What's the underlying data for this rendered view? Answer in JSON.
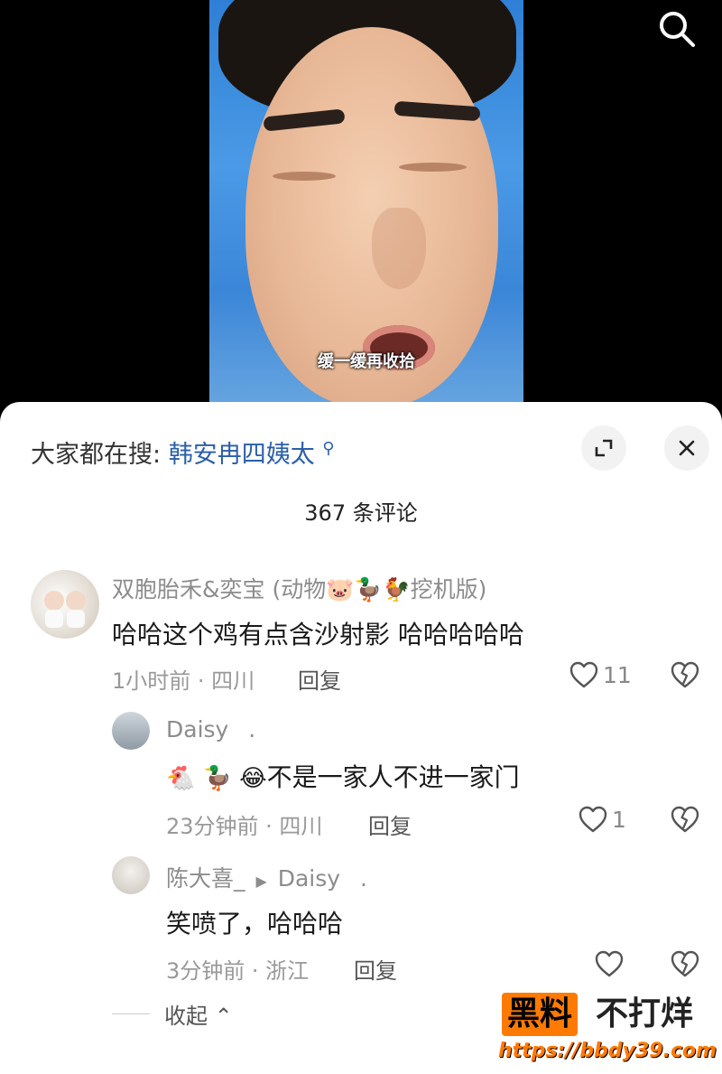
{
  "video": {
    "caption": "缓一缓再收拾"
  },
  "header": {
    "trend_prefix": "大家都在搜:",
    "trend_query": "韩安冉四姨太",
    "comment_count": "367 条评论"
  },
  "comments": [
    {
      "name": "双胞胎禾&奕宝 (动物🐷🦆🐓挖机版)",
      "text": "哈哈这个鸡有点含沙射影 哈哈哈哈哈",
      "meta": "1小时前 · 四川",
      "reply_label": "回复",
      "likes": "11"
    }
  ],
  "replies": [
    {
      "name": "Daisy",
      "dot": ".",
      "emojis": "🐔 🦆 😂",
      "text": "不是一家人不进一家门",
      "meta": "23分钟前 · 四川",
      "reply_label": "回复",
      "likes": "1"
    },
    {
      "name": "陈大喜_",
      "arrow": "▶",
      "reply_to": "Daisy",
      "dot": ".",
      "text": "笑喷了，哈哈哈",
      "meta": "3分钟前 · 浙江",
      "reply_label": "回复",
      "likes": ""
    }
  ],
  "collapse_label": "收起 ⌃",
  "watermark": {
    "brand1": "黑料",
    "brand2": "不打烊",
    "url": "https://bbdy39.com"
  },
  "colors": {
    "link": "#2a5fa8",
    "watermark": "#ff7a00"
  }
}
